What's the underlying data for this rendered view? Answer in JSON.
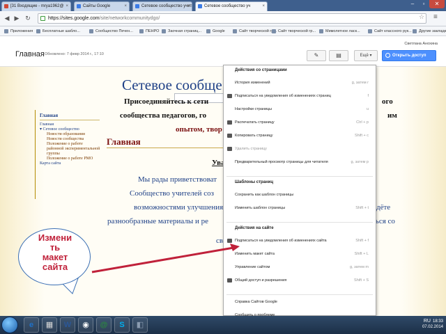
{
  "browser": {
    "tabs": [
      {
        "label": "[31 Входящие - mrya1962@",
        "fav": "#d14836"
      },
      {
        "label": "Сайты Google",
        "fav": "#3b7be5"
      },
      {
        "label": "Сетевое сообщество учит",
        "fav": "#3b7be5"
      },
      {
        "label": "Сетевое сообщество уч",
        "fav": "#3b7be5"
      }
    ],
    "url_domain": "https://sites.google.com",
    "url_path": "/site/networkcommunitydgo/",
    "bookmarks": [
      "Приложения",
      "Бесплатные шабло...",
      "Сообщество Печен...",
      "ПЕНРО",
      "Заочная страниц...",
      "Google",
      "Сайт творческой гр...",
      "Сайт творческой гр...",
      "Мимолетное ласк...",
      "Сайт классного рук...",
      "Другие закладки"
    ]
  },
  "sites_header": {
    "user": "Светлана Анохина",
    "page_title": "Главная",
    "created": "Обновлено: 7 февр 2014 г., 17:10",
    "more_label": "Ещё",
    "share_label": "Открыть доступ"
  },
  "site": {
    "title": "Сетевое сообщест",
    "sidebar_heading": "Главная",
    "nav": [
      {
        "label": "Главная",
        "sub": false
      },
      {
        "label": "▾ Сетевое сообщество",
        "sub": false
      },
      {
        "label": "Новости образования",
        "sub": true
      },
      {
        "label": "Новости сообщества",
        "sub": true
      },
      {
        "label": "Положение о работе",
        "sub": true
      },
      {
        "label": "районной экспериментальной",
        "sub": true
      },
      {
        "label": "группы",
        "sub": true
      },
      {
        "label": "Положение о работе РМО",
        "sub": true
      },
      {
        "label": "Карта сайта",
        "sub": false
      }
    ],
    "main_heading": "Главная",
    "lines": [
      {
        "text": "Присоединяйтесь к сети",
        "style": "blk"
      },
      {
        "text": "ого",
        "style": "blk"
      },
      {
        "text": "сообщества педагогов, го",
        "style": "blk"
      },
      {
        "text": "им",
        "style": "blk"
      },
      {
        "text": "опытом, твор",
        "style": "red"
      },
      {
        "text": "Ува",
        "style": "blk"
      },
      {
        "text": "Мы рады приветствоват",
        "style": "blu"
      },
      {
        "text": "Сообщество учителей соз",
        "style": "blu"
      },
      {
        "text": "возможностями улучшения к",
        "style": "blu"
      },
      {
        "text": "дёте",
        "style": "blu"
      },
      {
        "text": "разнообразные материалы и ре",
        "style": "blu"
      },
      {
        "text": "ться со",
        "style": "blu"
      },
      {
        "text": "своим коллегами.",
        "style": "blu"
      }
    ]
  },
  "menu": {
    "sections": [
      {
        "title": "Действия со страницами",
        "items": [
          {
            "label": "История изменений",
            "kb": "g, затем r",
            "icon": false,
            "disabled": false
          },
          {
            "label": "Подписаться на уведомления об изменениях страниц",
            "kb": "f",
            "icon": true,
            "disabled": false
          },
          {
            "label": "Настройки страницы",
            "kb": "u",
            "icon": false,
            "disabled": false
          },
          {
            "label": "Распечатать страницу",
            "kb": "Ctrl + p",
            "icon": true,
            "disabled": false
          },
          {
            "label": "Копировать страницу",
            "kb": "Shift + c",
            "icon": true,
            "disabled": false
          },
          {
            "label": "Удалить страницу",
            "kb": "",
            "icon": true,
            "disabled": true
          },
          {
            "label": "Предварительный просмотр страницы для читателя",
            "kb": "g, затем p",
            "icon": false,
            "disabled": false
          }
        ]
      },
      {
        "title": "Шаблоны страниц",
        "items": [
          {
            "label": "Сохранить как шаблон страницы",
            "kb": "",
            "icon": false,
            "disabled": false
          },
          {
            "label": "Изменить шаблон страницы",
            "kb": "Shift + t",
            "icon": false,
            "disabled": false
          }
        ]
      },
      {
        "title": "Действия на сайте",
        "items": [
          {
            "label": "Подписаться на уведомления об изменениях сайта",
            "kb": "Shift + f",
            "icon": true,
            "disabled": false
          },
          {
            "label": "Изменить макет сайта",
            "kb": "Shift + L",
            "icon": false,
            "disabled": false
          },
          {
            "label": "Управление сайтом",
            "kb": "g, затем m",
            "icon": false,
            "disabled": false
          },
          {
            "label": "Общий доступ и разрешения",
            "kb": "Shift + S",
            "icon": true,
            "disabled": false
          }
        ]
      },
      {
        "title": "",
        "items": [
          {
            "label": "Справка Сайтов Google",
            "kb": "",
            "icon": false,
            "disabled": false
          },
          {
            "label": "Сообщить о проблеме",
            "kb": "",
            "icon": false,
            "disabled": false
          }
        ]
      }
    ]
  },
  "callout": {
    "text": "Изменить макет сайта"
  },
  "taskbar": {
    "apps": [
      "e",
      "▦",
      "W",
      "◉",
      "@",
      "S",
      "◧"
    ],
    "tray": "RU",
    "time": "18:33",
    "date": "07.02.2014"
  }
}
